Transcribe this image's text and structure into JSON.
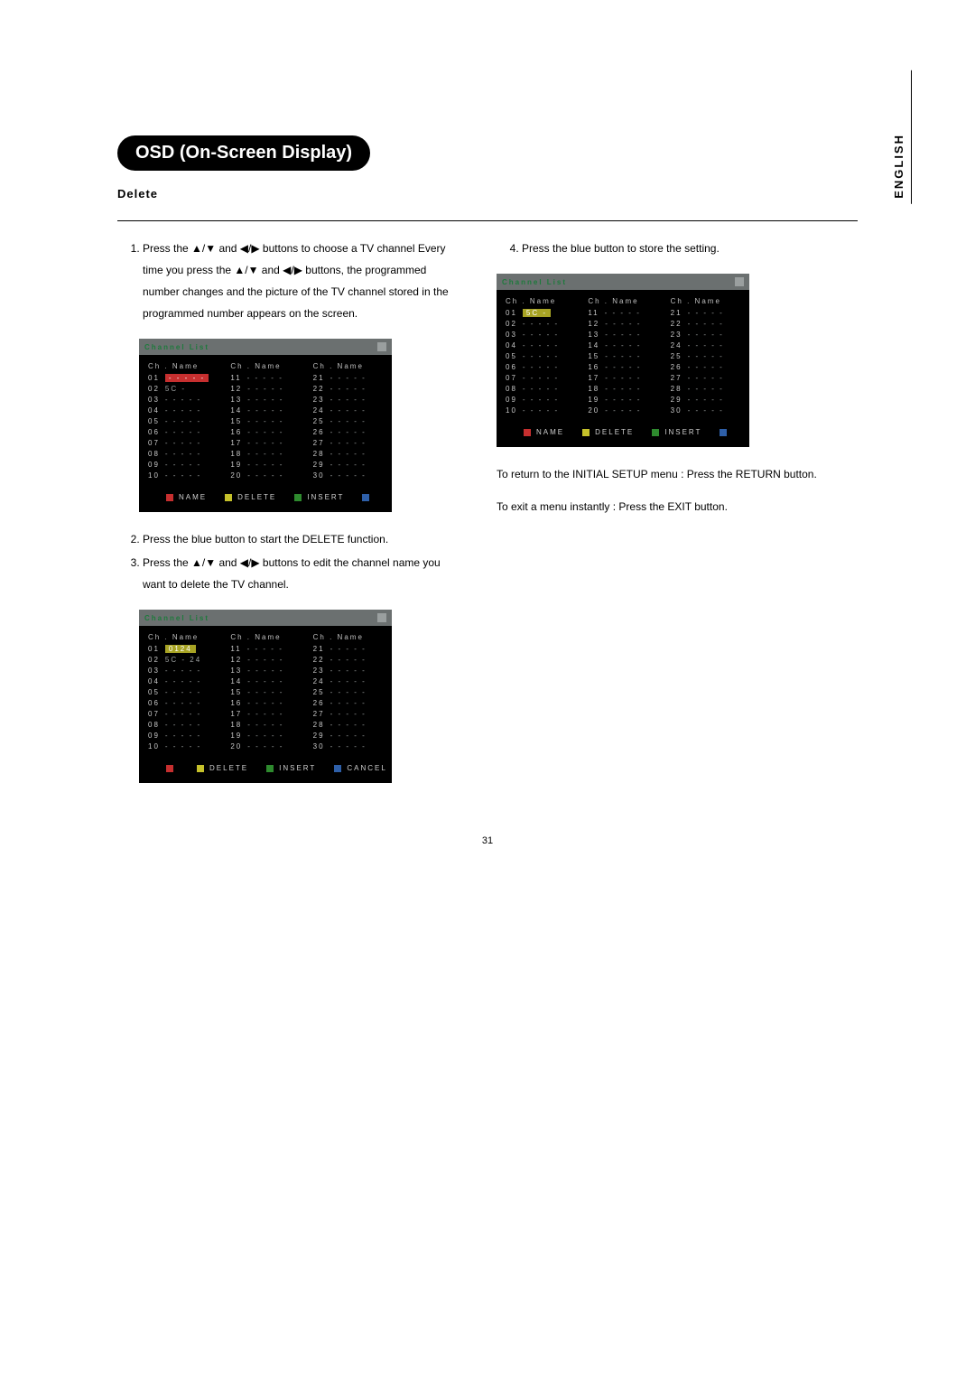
{
  "pageNumber": "31",
  "sideTab": "ENGLISH",
  "header": {
    "title": "OSD (On-Screen Display)"
  },
  "section": {
    "subhead": "Delete"
  },
  "left": {
    "step1": "Press the ▲/▼ and ◀/▶ buttons to choose a TV channel Every time you press the ▲/▼ and ◀/▶ buttons, the programmed number changes and the picture of the TV channel stored in the programmed number appears on the screen.",
    "step2": "Press the blue button to start the DELETE function.",
    "step3": "Press the ▲/▼ and ◀/▶ buttons to edit the channel name you want to delete the TV channel."
  },
  "right": {
    "step4": "Press the blue button to store the setting.",
    "note1": "To return to the INITIAL SETUP menu : Press the RETURN button.",
    "note2": "To exit a menu instantly : Press the EXIT button."
  },
  "osdCommon": {
    "title": "Channel  List",
    "colHeader": "Ch . Name",
    "dash": "- - - - -"
  },
  "osd1": {
    "col1": [
      {
        "n": "01",
        "v": "- - - - -",
        "hl": "red"
      },
      {
        "n": "02",
        "v": "5C -"
      },
      {
        "n": "03",
        "v": "- - - - -"
      },
      {
        "n": "04",
        "v": "- - - - -"
      },
      {
        "n": "05",
        "v": "- - - - -"
      },
      {
        "n": "06",
        "v": "- - - - -"
      },
      {
        "n": "07",
        "v": "- - - - -"
      },
      {
        "n": "08",
        "v": "- - - - -"
      },
      {
        "n": "09",
        "v": "- - - - -"
      },
      {
        "n": "10",
        "v": "- - - - -"
      }
    ],
    "col2": [
      {
        "n": "11",
        "v": "- - - - -"
      },
      {
        "n": "12",
        "v": "- - - - -"
      },
      {
        "n": "13",
        "v": "- - - - -"
      },
      {
        "n": "14",
        "v": "- - - - -"
      },
      {
        "n": "15",
        "v": "- - - - -"
      },
      {
        "n": "16",
        "v": "- - - - -"
      },
      {
        "n": "17",
        "v": "- - - - -"
      },
      {
        "n": "18",
        "v": "- - - - -"
      },
      {
        "n": "19",
        "v": "- - - - -"
      },
      {
        "n": "20",
        "v": "- - - - -"
      }
    ],
    "col3": [
      {
        "n": "21",
        "v": "- - - - -"
      },
      {
        "n": "22",
        "v": "- - - - -"
      },
      {
        "n": "23",
        "v": "- - - - -"
      },
      {
        "n": "24",
        "v": "- - - - -"
      },
      {
        "n": "25",
        "v": "- - - - -"
      },
      {
        "n": "26",
        "v": "- - - - -"
      },
      {
        "n": "27",
        "v": "- - - - -"
      },
      {
        "n": "28",
        "v": "- - - - -"
      },
      {
        "n": "29",
        "v": "- - - - -"
      },
      {
        "n": "30",
        "v": "- - - - -"
      }
    ],
    "legend": [
      {
        "color": "red",
        "label": "NAME"
      },
      {
        "color": "yellow",
        "label": "DELETE"
      },
      {
        "color": "green",
        "label": "INSERT"
      },
      {
        "color": "blue",
        "label": ""
      }
    ]
  },
  "osd2": {
    "col1": [
      {
        "n": "01",
        "v": " 0124",
        "hl": "grn"
      },
      {
        "n": "02",
        "v": "5C - 24"
      },
      {
        "n": "03",
        "v": "- - - - -"
      },
      {
        "n": "04",
        "v": "- - - - -"
      },
      {
        "n": "05",
        "v": "- - - - -"
      },
      {
        "n": "06",
        "v": "- - - - -"
      },
      {
        "n": "07",
        "v": "- - - - -"
      },
      {
        "n": "08",
        "v": "- - - - -"
      },
      {
        "n": "09",
        "v": "- - - - -"
      },
      {
        "n": "10",
        "v": "- - - - -"
      }
    ],
    "col2": [
      {
        "n": "11",
        "v": "- - - - -"
      },
      {
        "n": "12",
        "v": "- - - - -"
      },
      {
        "n": "13",
        "v": "- - - - -"
      },
      {
        "n": "14",
        "v": "- - - - -"
      },
      {
        "n": "15",
        "v": "- - - - -"
      },
      {
        "n": "16",
        "v": "- - - - -"
      },
      {
        "n": "17",
        "v": "- - - - -"
      },
      {
        "n": "18",
        "v": "- - - - -"
      },
      {
        "n": "19",
        "v": "- - - - -"
      },
      {
        "n": "20",
        "v": "- - - - -"
      }
    ],
    "col3": [
      {
        "n": "21",
        "v": "- - - - -"
      },
      {
        "n": "22",
        "v": "- - - - -"
      },
      {
        "n": "23",
        "v": "- - - - -"
      },
      {
        "n": "24",
        "v": "- - - - -"
      },
      {
        "n": "25",
        "v": "- - - - -"
      },
      {
        "n": "26",
        "v": "- - - - -"
      },
      {
        "n": "27",
        "v": "- - - - -"
      },
      {
        "n": "28",
        "v": "- - - - -"
      },
      {
        "n": "29",
        "v": "- - - - -"
      },
      {
        "n": "30",
        "v": "- - - - -"
      }
    ],
    "legend": [
      {
        "color": "red",
        "label": ""
      },
      {
        "color": "yellow",
        "label": "DELETE"
      },
      {
        "color": "green",
        "label": "INSERT"
      },
      {
        "color": "blue",
        "label": "CANCEL"
      }
    ]
  },
  "osd3": {
    "col1": [
      {
        "n": "01",
        "v": "5C -",
        "hl": "grn"
      },
      {
        "n": "02",
        "v": "- - - - -"
      },
      {
        "n": "03",
        "v": "- - - - -"
      },
      {
        "n": "04",
        "v": "- - - - -"
      },
      {
        "n": "05",
        "v": "- - - - -"
      },
      {
        "n": "06",
        "v": "- - - - -"
      },
      {
        "n": "07",
        "v": "- - - - -"
      },
      {
        "n": "08",
        "v": "- - - - -"
      },
      {
        "n": "09",
        "v": "- - - - -"
      },
      {
        "n": "10",
        "v": "- - - - -"
      }
    ],
    "col2": [
      {
        "n": "11",
        "v": "- - - - -"
      },
      {
        "n": "12",
        "v": "- - - - -"
      },
      {
        "n": "13",
        "v": "- - - - -"
      },
      {
        "n": "14",
        "v": "- - - - -"
      },
      {
        "n": "15",
        "v": "- - - - -"
      },
      {
        "n": "16",
        "v": "- - - - -"
      },
      {
        "n": "17",
        "v": "- - - - -"
      },
      {
        "n": "18",
        "v": "- - - - -"
      },
      {
        "n": "19",
        "v": "- - - - -"
      },
      {
        "n": "20",
        "v": "- - - - -"
      }
    ],
    "col3": [
      {
        "n": "21",
        "v": "- - - - -"
      },
      {
        "n": "22",
        "v": "- - - - -"
      },
      {
        "n": "23",
        "v": "- - - - -"
      },
      {
        "n": "24",
        "v": "- - - - -"
      },
      {
        "n": "25",
        "v": "- - - - -"
      },
      {
        "n": "26",
        "v": "- - - - -"
      },
      {
        "n": "27",
        "v": "- - - - -"
      },
      {
        "n": "28",
        "v": "- - - - -"
      },
      {
        "n": "29",
        "v": "- - - - -"
      },
      {
        "n": "30",
        "v": "- - - - -"
      }
    ],
    "legend": [
      {
        "color": "red",
        "label": "NAME"
      },
      {
        "color": "yellow",
        "label": "DELETE"
      },
      {
        "color": "green",
        "label": "INSERT"
      },
      {
        "color": "blue",
        "label": ""
      }
    ]
  }
}
